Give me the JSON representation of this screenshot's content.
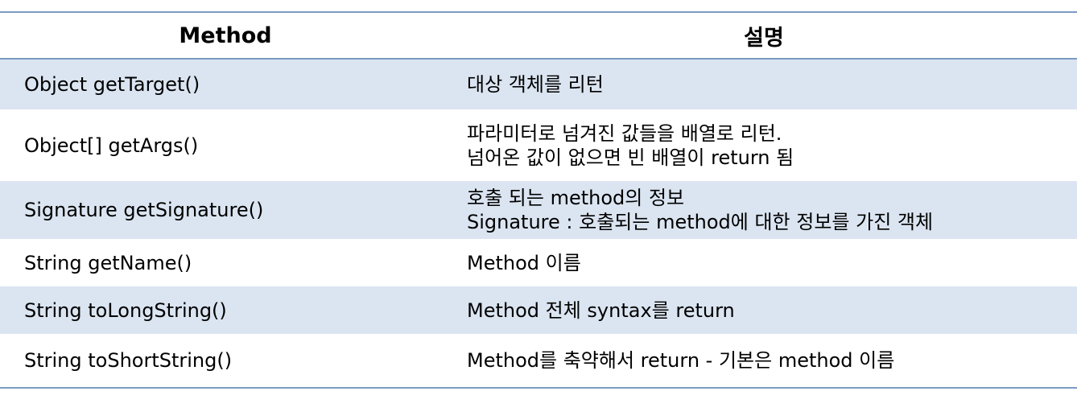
{
  "table": {
    "headers": [
      "Method",
      "설명"
    ],
    "rows": [
      {
        "method": "Object getTarget()",
        "desc": [
          "대상 객체를 리턴"
        ]
      },
      {
        "method": "Object[] getArgs()",
        "desc": [
          "파라미터로 넘겨진 값들을 배열로 리턴.",
          "넘어온 값이 없으면 빈 배열이 return 됨"
        ]
      },
      {
        "method": "Signature getSignature()",
        "desc": [
          "호출 되는 method의 정보",
          "Signature : 호출되는 method에 대한 정보를 가진 객체"
        ]
      },
      {
        "method": "String getName()",
        "desc": [
          "Method 이름"
        ]
      },
      {
        "method": "String toLongString()",
        "desc": [
          "Method 전체 syntax를 return"
        ]
      },
      {
        "method": "String toShortString()",
        "desc": [
          "Method를 축약해서 return - 기본은 method 이름"
        ]
      }
    ]
  },
  "colors": {
    "border": "#7b9bc2",
    "shaded_row": "#dbe5f1",
    "plain_row": "#ffffff"
  }
}
